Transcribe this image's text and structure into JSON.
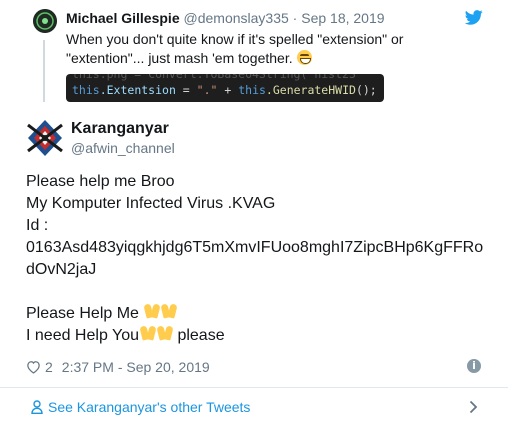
{
  "parent_tweet": {
    "name": "Michael Gillespie",
    "handle": "@demonslay335",
    "separator": "·",
    "date": "Sep 18, 2019",
    "text": "When you don't quite know if it's spelled \"extension\" or \"extention\"... just mash 'em together.",
    "code": {
      "keyword1": "this",
      "prop": ".Extentsion",
      "op": " = ",
      "str": "\".\"",
      "plus": " + ",
      "keyword2": "this",
      "call": ".GenerateHWID",
      "tail": "();"
    }
  },
  "tweet": {
    "name": "Karanganyar",
    "handle": "@afwin_channel",
    "lines": [
      "Please help me Broo",
      "My Komputer Infected Virus .KVAG",
      "Id :",
      "0163Asd483yiqgkhjdg6T5mXmvIFUoo8mghI7ZipcBHp6KgFFRo",
      "dOvN2jaJ",
      "Please Help Me ",
      "I need Help You",
      " please"
    ],
    "likes": "2",
    "timestamp": "2:37 PM - Sep 20, 2019"
  },
  "footer": {
    "link_text": "See Karanganyar's other Tweets"
  },
  "colors": {
    "link": "#1b95e0",
    "secondary": "#657786",
    "twitter_blue": "#1da1f2"
  },
  "icons": [
    "twitter-bird-icon",
    "grinning-emoji-icon",
    "folded-hands-emoji-icon",
    "heart-icon",
    "info-icon",
    "person-icon",
    "chevron-right-icon"
  ]
}
